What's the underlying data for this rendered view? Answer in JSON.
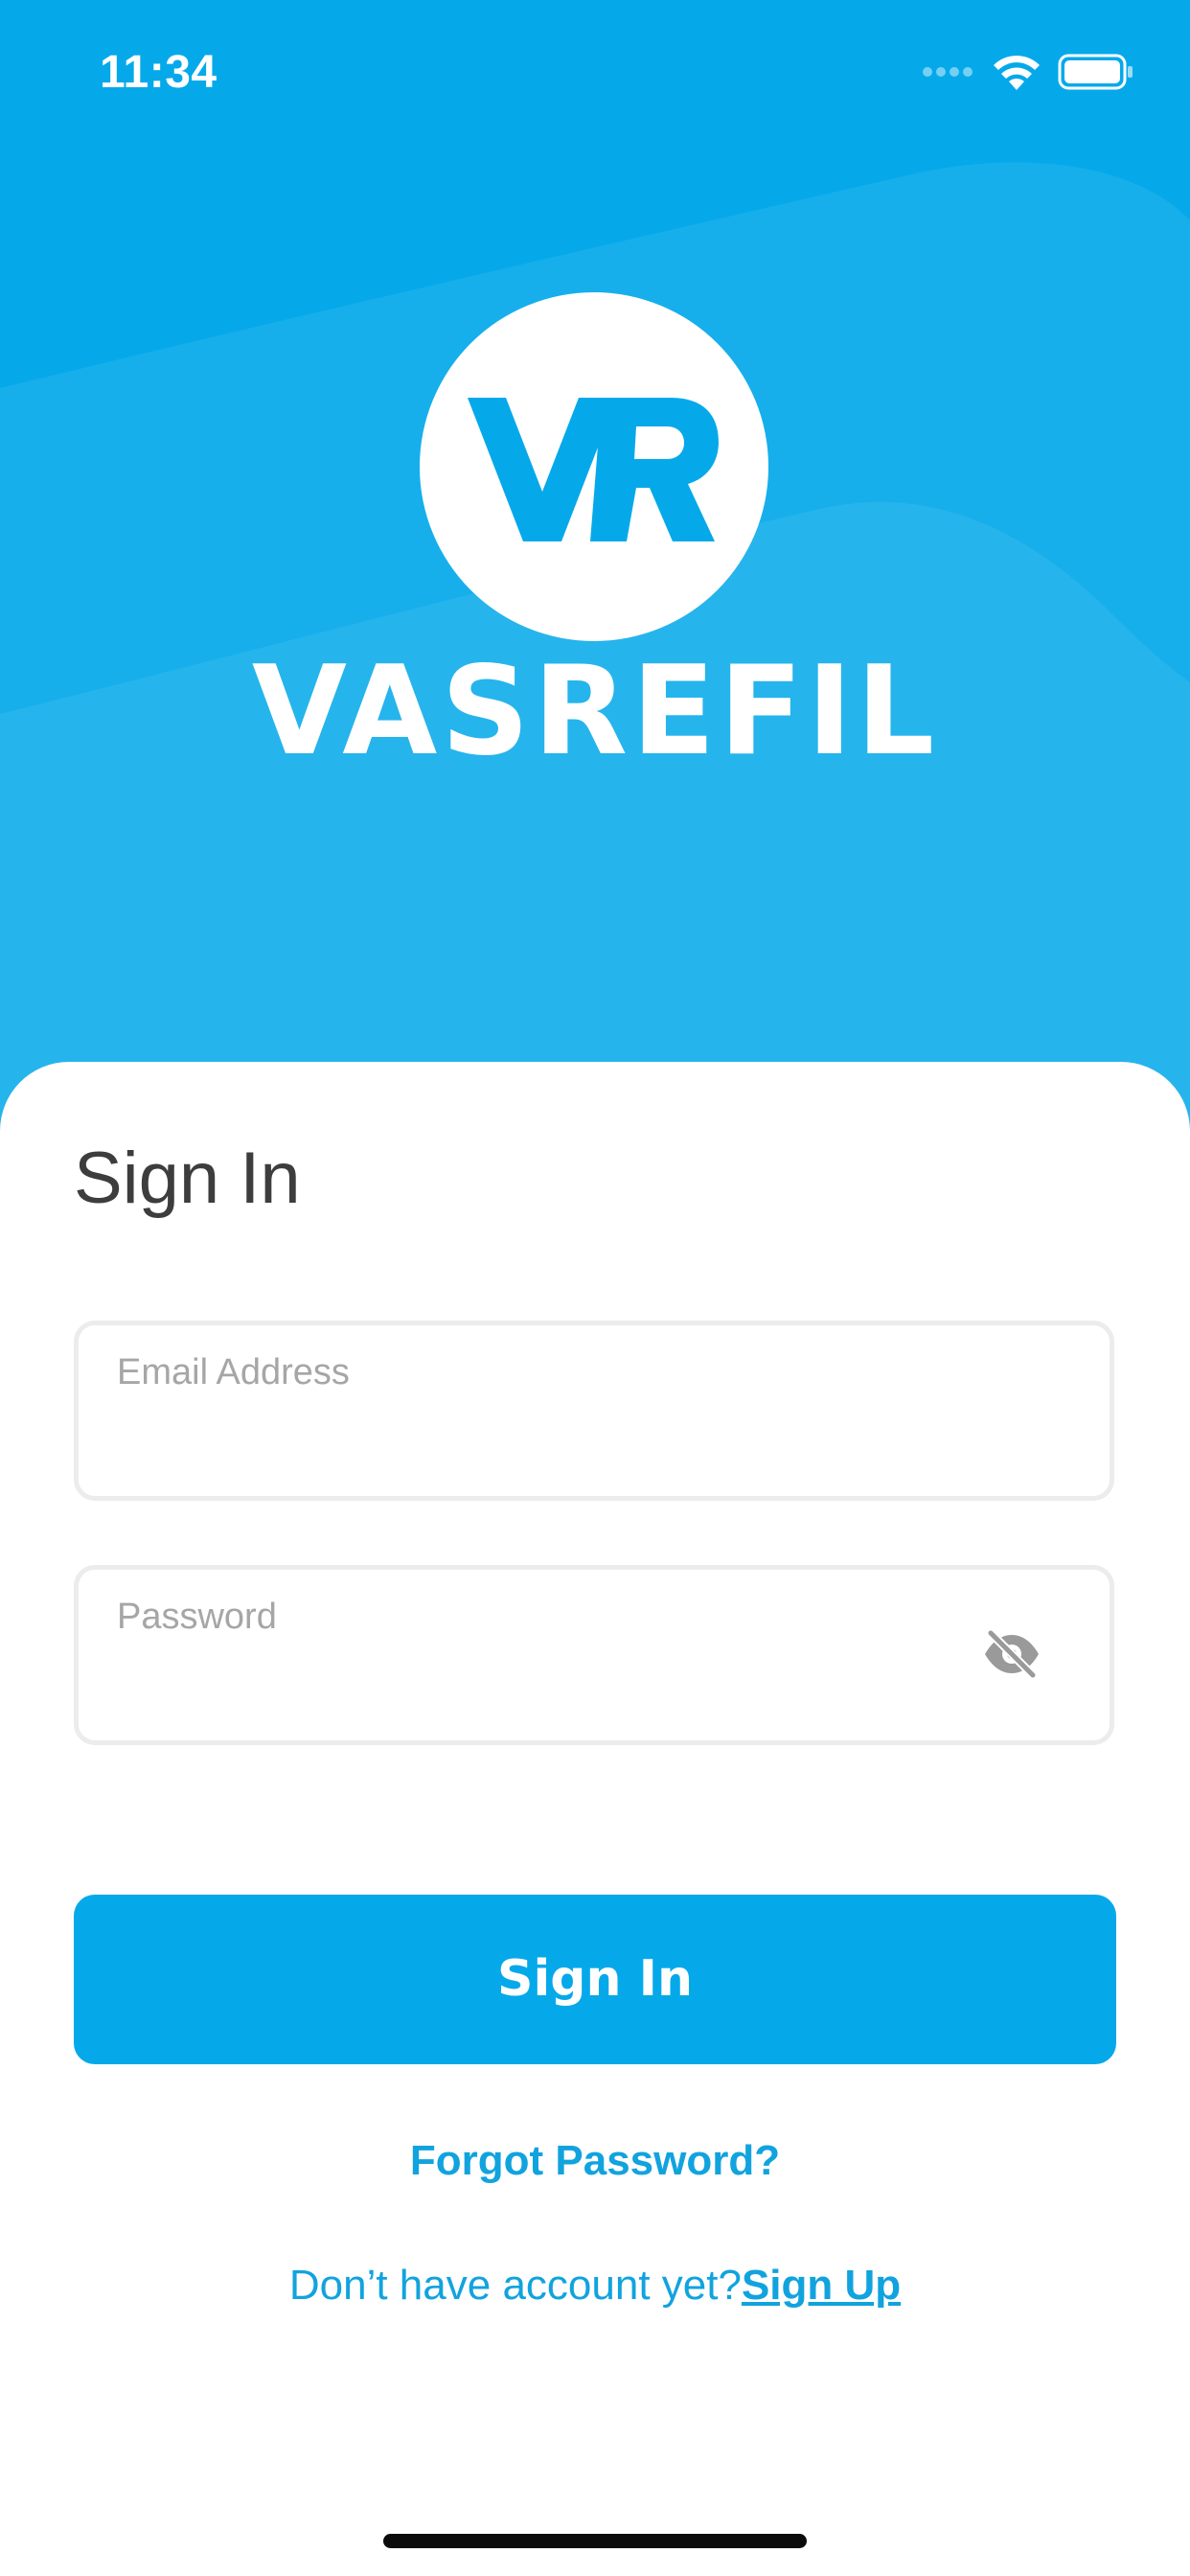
{
  "status_bar": {
    "time": "11:34",
    "signal_icon": "cellular-dots-icon",
    "wifi_icon": "wifi-icon",
    "battery_icon": "battery-icon"
  },
  "brand": {
    "logo_text": "VR",
    "name": "VASREFIL",
    "primary_color": "#05a9ea"
  },
  "form": {
    "title": "Sign In",
    "email": {
      "label": "Email Address",
      "value": ""
    },
    "password": {
      "label": "Password",
      "value": "",
      "toggle_icon": "eye-off-icon"
    },
    "submit_label": "Sign In",
    "forgot_label": "Forgot Password?",
    "signup_prompt": "Don’t have account yet?",
    "signup_label": "Sign Up"
  }
}
